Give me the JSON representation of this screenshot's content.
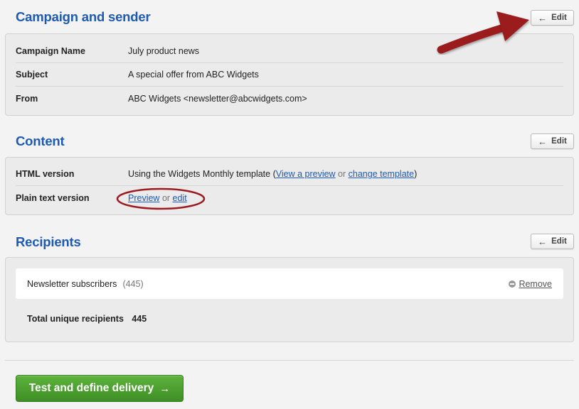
{
  "campaign_section": {
    "title": "Campaign and sender",
    "edit_label": "Edit",
    "rows": [
      {
        "label": "Campaign Name",
        "value": "July product news"
      },
      {
        "label": "Subject",
        "value": "A special offer from ABC Widgets"
      },
      {
        "label": "From",
        "value": "ABC Widgets <newsletter@abcwidgets.com>"
      }
    ]
  },
  "content_section": {
    "title": "Content",
    "edit_label": "Edit",
    "html_version": {
      "label": "HTML version",
      "text_before": "Using the Widgets Monthly template (",
      "preview_link": "View a preview",
      "or_text": " or ",
      "change_link": "change template",
      "text_after": ")"
    },
    "plain_text_version": {
      "label": "Plain text version",
      "preview_link": "Preview",
      "or_text": " or ",
      "edit_link": "edit"
    }
  },
  "recipients_section": {
    "title": "Recipients",
    "edit_label": "Edit",
    "lists": [
      {
        "name": "Newsletter subscribers",
        "count": "(445)",
        "remove_label": "Remove"
      }
    ],
    "total_label": "Total unique recipients",
    "total_value": "445"
  },
  "footer": {
    "primary_button_label": "Test and define delivery"
  },
  "icons": {
    "edit_arrow": "arrow-left-icon",
    "primary_arrow": "arrow-right-icon",
    "remove": "minus-circle-icon"
  },
  "colors": {
    "heading_blue": "#1e5bb0",
    "link_blue": "#1e5bb0",
    "primary_green": "#4ea030",
    "annotation_red": "#9b1b1f"
  }
}
